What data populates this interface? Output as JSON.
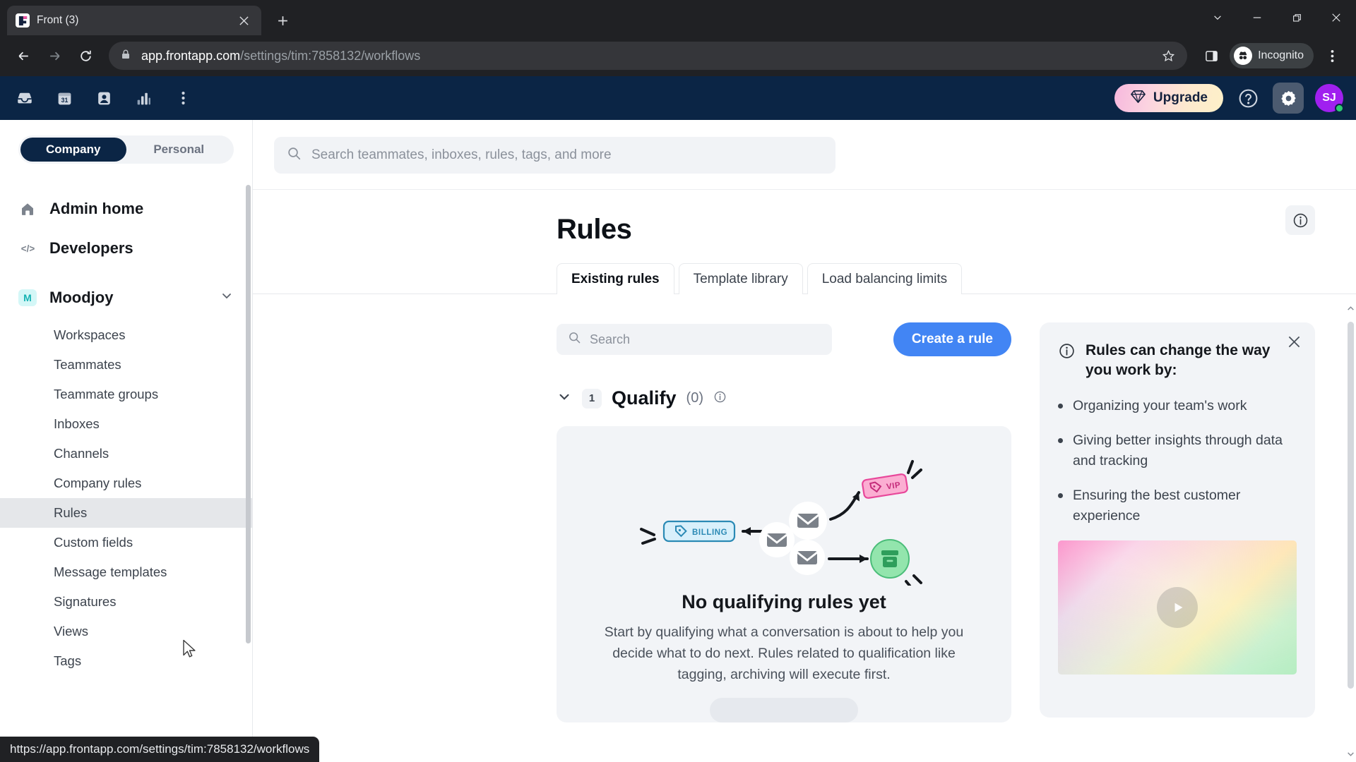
{
  "browser": {
    "tab": {
      "title": "Front (3)",
      "favicon_name": "front-logo-icon"
    },
    "url_domain": "app.frontapp.com",
    "url_path": "/settings/tim:7858132/workflows",
    "profile_label": "Incognito",
    "status_url": "https://app.frontapp.com/settings/tim:7858132/workflows"
  },
  "app_header": {
    "icons": [
      "inbox-icon",
      "calendar-icon",
      "contacts-icon",
      "analytics-icon",
      "more-options-icon"
    ],
    "upgrade_label": "Upgrade",
    "avatar_initials": "SJ",
    "accent_navy": "#0b2545",
    "accent_purple": "#a020ef",
    "status_green": "#2ecc71"
  },
  "sidebar": {
    "segments": [
      {
        "label": "Company",
        "active": true
      },
      {
        "label": "Personal",
        "active": false
      }
    ],
    "nav": [
      {
        "label": "Admin home",
        "icon": "home-icon"
      },
      {
        "label": "Developers",
        "icon": "code-icon"
      }
    ],
    "team": {
      "label": "Moodjoy",
      "badge": "M",
      "expanded": true
    },
    "items": [
      {
        "label": "Workspaces",
        "active": false
      },
      {
        "label": "Teammates",
        "active": false
      },
      {
        "label": "Teammate groups",
        "active": false
      },
      {
        "label": "Inboxes",
        "active": false
      },
      {
        "label": "Channels",
        "active": false
      },
      {
        "label": "Company rules",
        "active": false
      },
      {
        "label": "Rules",
        "active": true
      },
      {
        "label": "Custom fields",
        "active": false
      },
      {
        "label": "Message templates",
        "active": false
      },
      {
        "label": "Signatures",
        "active": false
      },
      {
        "label": "Views",
        "active": false
      },
      {
        "label": "Tags",
        "active": false
      }
    ]
  },
  "main": {
    "global_search_placeholder": "Search teammates, inboxes, rules, tags, and more",
    "page_title": "Rules",
    "tabs": [
      {
        "label": "Existing rules",
        "active": true
      },
      {
        "label": "Template library",
        "active": false
      },
      {
        "label": "Load balancing limits",
        "active": false
      }
    ],
    "rules_search_placeholder": "Search",
    "create_button": "Create a rule",
    "section": {
      "number": "1",
      "title": "Qualify",
      "count": "(0)"
    },
    "empty_state": {
      "title": "No qualifying rules yet",
      "body": "Start by qualifying what a conversation is about to help you decide what to do next. Rules related to qualification like tagging, archiving will execute first.",
      "illustration": {
        "billing_tag": "BILLING",
        "vip_tag": "VIP",
        "billing_color": "#2b8ab5",
        "vip_color": "#e8479a",
        "archive_color": "#7fe0a0"
      }
    }
  },
  "info_panel": {
    "title": "Rules can change the way you work by:",
    "bullets": [
      "Organizing your team's work",
      "Giving better insights through data and tracking",
      "Ensuring the best customer experience"
    ]
  }
}
